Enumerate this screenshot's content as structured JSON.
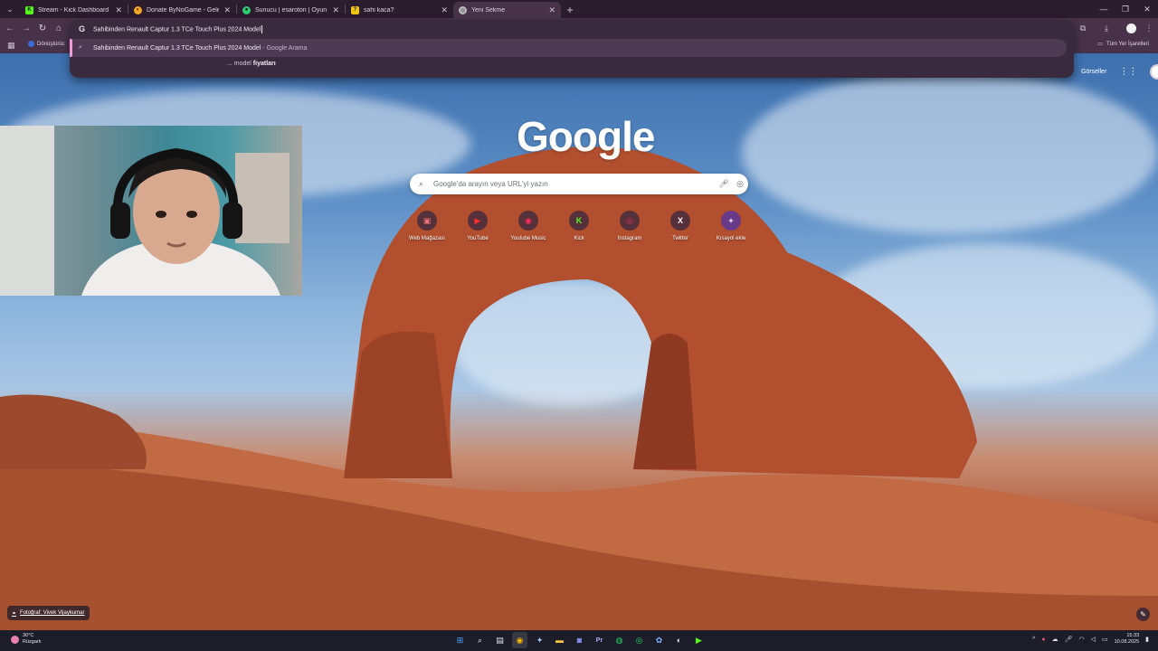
{
  "tabs": [
    {
      "title": "Stream - Kick Dashboard",
      "favicon": "kick-icon",
      "color": "#53fc18"
    },
    {
      "title": "Donate ByNoGame - Gelen/Gi",
      "favicon": "bynogame-icon",
      "color": "#f5a623"
    },
    {
      "title": "Sunucu | esaroton | Oyun sunu",
      "favicon": "server-icon",
      "color": "#2ecc71"
    },
    {
      "title": "sahi kaca?",
      "favicon": "question-icon",
      "color": "#f1c40f"
    },
    {
      "title": "Yeni Sekme",
      "favicon": "chrome-icon",
      "color": "#bbbbbb"
    }
  ],
  "omnibox": {
    "engine_letter": "G",
    "query": "Sahibinden Renault Captur 1.3 TCe Touch Plus 2024 Model",
    "suggestion_main": "Sahibinden Renault Captur 1.3 TCe Touch Plus 2024 Model",
    "suggestion_sub": " - Google Arama",
    "suggestion2_prefix": "... model ",
    "suggestion2_bold": "fiyatları"
  },
  "bookmarks": {
    "item1": "Dönüştürüc",
    "all_bookmarks": "Tüm Yer İşaretleri"
  },
  "newtab": {
    "logo": "Google",
    "search_placeholder": "Google'da arayın veya URL'yi yazın",
    "images_link": "Görseller",
    "shortcuts": [
      {
        "label": "Web Mağazası",
        "icon": "webstore-icon",
        "glyph": "▣",
        "color": "#e57373"
      },
      {
        "label": "YouTube",
        "icon": "youtube-icon",
        "glyph": "▶",
        "color": "#ff2d2d"
      },
      {
        "label": "Youtube Music",
        "icon": "youtube-music-icon",
        "glyph": "◉",
        "color": "#ff2d55"
      },
      {
        "label": "Kick",
        "icon": "kick-icon",
        "glyph": "K",
        "color": "#53fc18"
      },
      {
        "label": "Instagram",
        "icon": "instagram-icon",
        "glyph": "◎",
        "color": "#e1306c"
      },
      {
        "label": "Twitter",
        "icon": "x-icon",
        "glyph": "X",
        "color": "#ffffff"
      },
      {
        "label": "Kısayol ekle",
        "icon": "plus-icon",
        "glyph": "+",
        "color": "#ffffff"
      }
    ],
    "photo_credit": "Fotoğraf: Vivek Vijaykumar"
  },
  "taskbar": {
    "temperature": "30°C",
    "weather": "Rüzgarlı",
    "time": "15:33",
    "date": "10.08.2025"
  }
}
